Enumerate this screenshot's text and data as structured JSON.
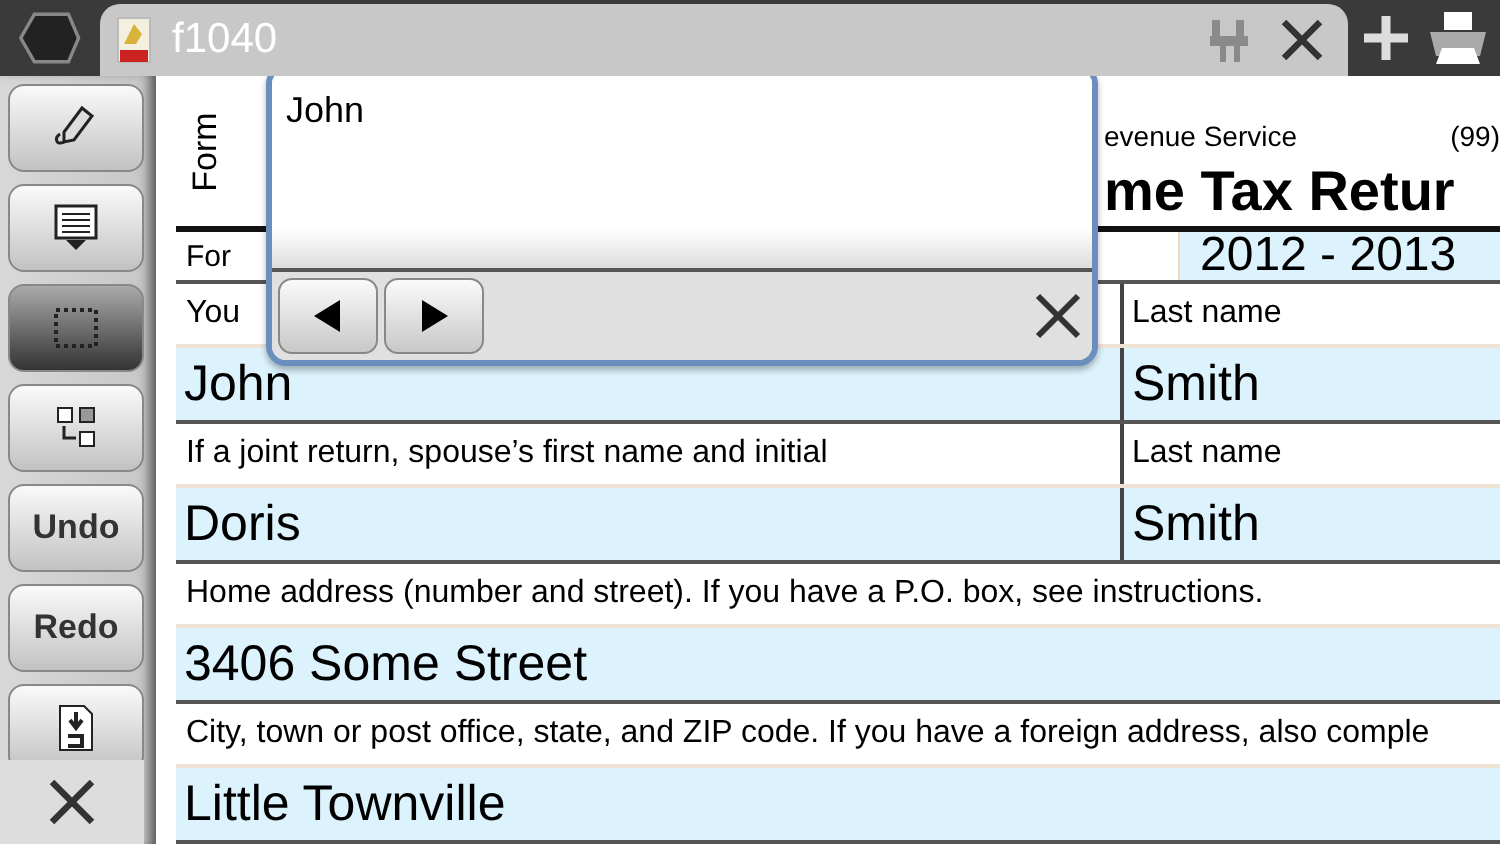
{
  "tab_bar": {
    "title": "f1040"
  },
  "toolbar": [
    {
      "kind": "icon",
      "selected": false
    },
    {
      "kind": "icon",
      "selected": false
    },
    {
      "kind": "icon",
      "selected": true
    },
    {
      "kind": "icon",
      "selected": false
    },
    {
      "kind": "text",
      "label": "Undo",
      "selected": false
    },
    {
      "kind": "text",
      "label": "Redo",
      "selected": false
    },
    {
      "kind": "icon",
      "selected": false
    }
  ],
  "popup": {
    "value": "John"
  },
  "form": {
    "form_label": "Form",
    "agency": "evenue Service",
    "form_code": "(99)",
    "title": "me Tax Retur",
    "year_prefix": "For",
    "tax_year": "2012 - 2013",
    "rows": [
      {
        "kind": "label",
        "cells": [
          "You",
          "Last name"
        ]
      },
      {
        "kind": "field",
        "cells": [
          "John",
          "Smith"
        ]
      },
      {
        "kind": "label",
        "cells": [
          "If a joint return, spouse’s first name and initial",
          "Last name"
        ]
      },
      {
        "kind": "field",
        "cells": [
          "Doris",
          "Smith"
        ]
      },
      {
        "kind": "label",
        "cells": [
          "Home address (number and street). If you have a P.O. box, see instructions."
        ]
      },
      {
        "kind": "field",
        "cells": [
          "3406 Some Street"
        ]
      },
      {
        "kind": "label",
        "cells": [
          "City, town or post office, state, and ZIP code. If you have a foreign address, also comple"
        ]
      },
      {
        "kind": "field",
        "cells": [
          "Little Townville"
        ]
      }
    ]
  }
}
